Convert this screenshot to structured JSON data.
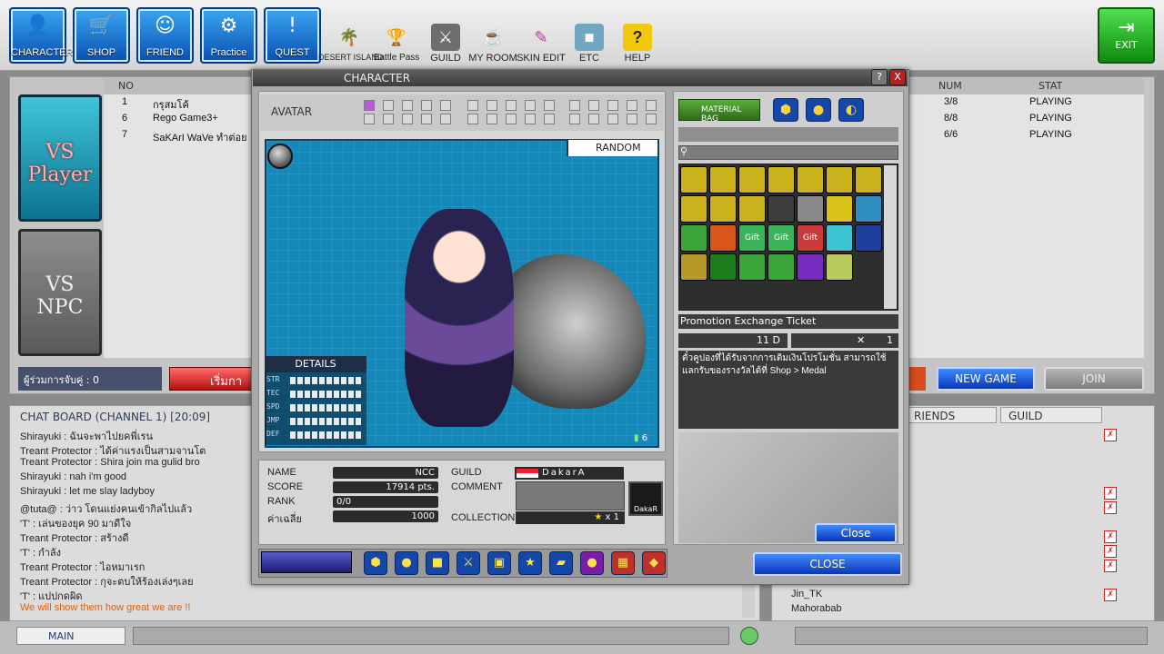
{
  "nav": {
    "character": "CHARACTER",
    "shop": "SHOP",
    "friend": "FRIEND",
    "practice": "Practice",
    "quest": "QUEST"
  },
  "toolbar": {
    "desert_island": "DESERT ISLAND",
    "battle_pass": "Battle Pass",
    "guild": "GUILD",
    "my_room": "MY ROOM",
    "skin_edit": "SKIN EDIT",
    "etc": "ETC",
    "help": "HELP",
    "exit": "EXIT"
  },
  "lobby": {
    "vs_player": "VS Player",
    "vs_npc": "VS NPC",
    "headers": {
      "no": "NO",
      "num": "NUM",
      "stat": "STAT"
    },
    "rooms": [
      {
        "no": "1",
        "name": "กรุสมโค้",
        "num": "3/8",
        "stat": "PLAYING"
      },
      {
        "no": "6",
        "name": "Rego Game3+",
        "num": "8/8",
        "stat": "PLAYING"
      },
      {
        "no": "7",
        "name": "SaKArI WaVe ทำต่อย",
        "num": "6/6",
        "stat": "PLAYING"
      }
    ],
    "players_count": "ผู้ร่วมการจับคู่ : 0",
    "start_partial": "เริ่มกา",
    "new_game": "NEW GAME",
    "join": "JOIN"
  },
  "chat": {
    "title": "CHAT BOARD (CHANNEL 1) [20:09]",
    "lines": [
      "Shirayuki : ฉันจะพาไปยคพี่เรน",
      "Treant Protector : ได้ค่าแรงเป็นสามจานโต",
      "Treant Protector : Shira join ma gulid bro",
      "Shirayuki : nah i'm good",
      "Shirayuki : let me slay ladyboy",
      "@tuta@ : ว่าว โดนแย่งคนเข้ากิลไปแล้ว",
      "'T' : เล่นของยุค 90 มาดีใจ",
      "Treant Protector : สร้างดี",
      "'T' : กำลัง",
      "Treant Protector : ไอหมาเรก",
      "Treant Protector : กุจะตบให้ร้องเล่งๆเลย",
      "'T' : แปปกดผิด",
      "We will show them how great we are !!"
    ],
    "channel_select": "MAIN"
  },
  "friends": {
    "tab_friends": "RIENDS",
    "tab_guild": "GUILD",
    "visible": [
      "Jin_TK",
      "Mahorabab"
    ]
  },
  "window": {
    "title": "CHARACTER",
    "help": "?",
    "close_x": "X",
    "avatar_label": "AVATAR",
    "random": "RANDOM",
    "details": "DETAILS",
    "stats": [
      "STR",
      "TEC",
      "SPD",
      "JMP",
      "DEF"
    ],
    "signal": "6",
    "info": {
      "name_label": "NAME",
      "name": "NCC",
      "score_label": "SCORE",
      "score": "17914 pts.",
      "rank_label": "RANK",
      "rank": "0/0",
      "avg_label": "ค่าเฉลี่ย",
      "avg": "1000",
      "guild_label": "GUILD",
      "guild": "DakarA",
      "comment_label": "COMMENT",
      "collection_label": "COLLECTION",
      "collection": "x 1",
      "emblem_text": "DakaR"
    },
    "bag": {
      "material_bag": "MATERIAL BAG",
      "item_name": "Promotion Exchange Ticket",
      "days": "11 D",
      "qty": "1",
      "description": "ตั๋วคูปองที่ได้รับจากการเติมเงินโปรโมชั่น สามารถใช้แลกรับของรางวัลได้ที่ Shop > Medal",
      "gift": "Gift"
    },
    "close_small": "Close",
    "close_big": "CLOSE"
  },
  "colors": {
    "accent_blue": "#1547a8",
    "stage_teal": "#1588b7",
    "exit_green": "#1fae1f"
  }
}
